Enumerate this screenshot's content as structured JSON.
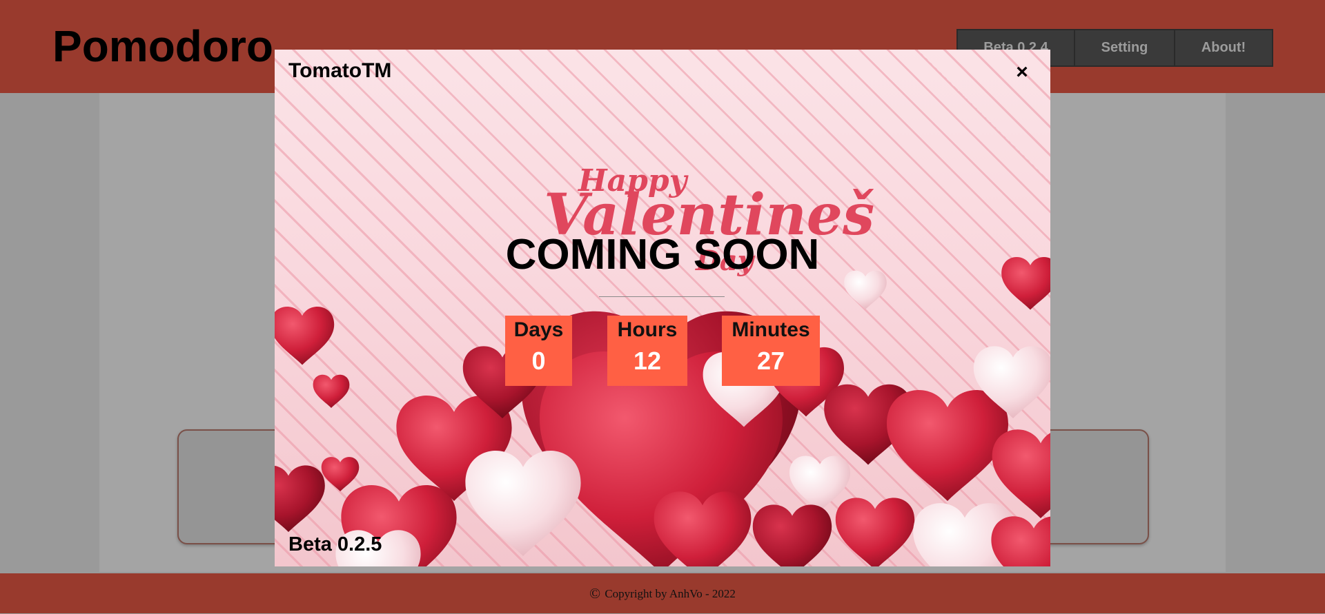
{
  "app": {
    "title": "Pomodoro"
  },
  "nav": {
    "items": [
      {
        "label": "Beta 0.2.4"
      },
      {
        "label": "Setting"
      },
      {
        "label": "About!"
      }
    ]
  },
  "modal": {
    "title": "TomatoTM",
    "close_label": "×",
    "artwork_text": {
      "line1": "Happy",
      "line2": "Valentineš",
      "line3": "Day"
    },
    "headline": "COMING SOON",
    "countdown": [
      {
        "label": "Days",
        "value": "0"
      },
      {
        "label": "Hours",
        "value": "12"
      },
      {
        "label": "Minutes",
        "value": "27"
      }
    ],
    "version": "Beta 0.2.5"
  },
  "footer": {
    "copyright_symbol": "©",
    "text": "Copyright by AnhVo - 2022"
  },
  "colors": {
    "header_bg": "#993a2d",
    "countdown_bg": "#ff6044",
    "heart_red": "#d21f3c",
    "heart_pink": "#f6d3d9"
  }
}
